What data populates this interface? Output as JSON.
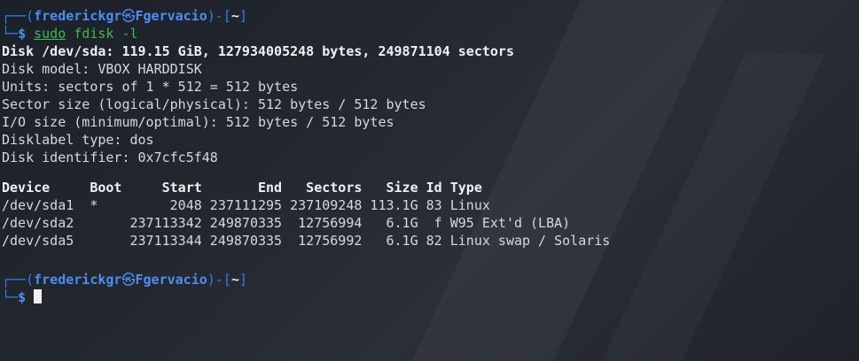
{
  "prompt1": {
    "user": "frederickgr",
    "skull": "㉿",
    "host": "Fgervacio",
    "dir": "~",
    "command": "sudo",
    "args": " fdisk -l"
  },
  "output": {
    "disk_line": "Disk /dev/sda: 119.15 GiB, 127934005248 bytes, 249871104 sectors",
    "model": "Disk model: VBOX HARDDISK",
    "units": "Units: sectors of 1 * 512 = 512 bytes",
    "sector_size": "Sector size (logical/physical): 512 bytes / 512 bytes",
    "io_size": "I/O size (minimum/optimal): 512 bytes / 512 bytes",
    "disklabel": "Disklabel type: dos",
    "identifier": "Disk identifier: 0x7cfc5f48"
  },
  "table": {
    "header": "Device     Boot     Start       End   Sectors   Size Id Type",
    "rows": [
      "/dev/sda1  *         2048 237111295 237109248 113.1G 83 Linux",
      "/dev/sda2       237113342 249870335  12756994   6.1G  f W95 Ext'd (LBA)",
      "/dev/sda5       237113344 249870335  12756992   6.1G 82 Linux swap / Solaris"
    ]
  },
  "prompt2": {
    "user": "frederickgr",
    "skull": "㉿",
    "host": "Fgervacio",
    "dir": "~"
  }
}
